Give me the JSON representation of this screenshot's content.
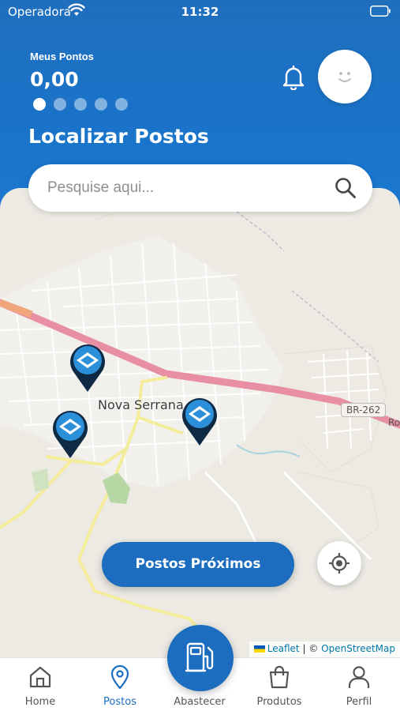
{
  "status_bar": {
    "carrier": "Operadora",
    "time": "11:32"
  },
  "header": {
    "points_label": "Meus Pontos",
    "points_value": "0,00",
    "carousel_dots": 5,
    "active_dot": 0,
    "title": "Localizar Postos"
  },
  "search": {
    "placeholder": "Pesquise aqui..."
  },
  "map": {
    "city_label": "Nova Serrana",
    "road_label": "BR-262",
    "road_label_2": "Ro",
    "attribution": {
      "leaflet": "Leaflet",
      "separator": "| ©",
      "osm": "OpenStreetMap"
    }
  },
  "actions": {
    "nearby_button": "Postos Próximos"
  },
  "nav": {
    "items": [
      {
        "label": "Home",
        "icon": "home-icon"
      },
      {
        "label": "Postos",
        "icon": "map-pin-icon"
      },
      {
        "label": "Abastecer",
        "icon": "fuel-pump-icon"
      },
      {
        "label": "Produtos",
        "icon": "shopping-bag-icon"
      },
      {
        "label": "Perfil",
        "icon": "user-icon"
      }
    ],
    "active": "Postos"
  },
  "colors": {
    "primary": "#1c6dbf",
    "header": "#1a73c9",
    "map_bg": "#eceae3",
    "highway": "#e88fa4"
  }
}
